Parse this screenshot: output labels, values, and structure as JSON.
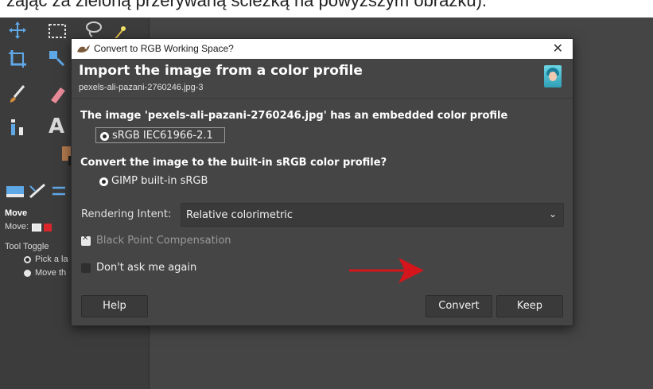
{
  "caption": {
    "text": "zając za zieloną przerywaną ścieżką na powyższym obrazku)."
  },
  "tool_options": {
    "title": "Move",
    "move_label": "Move:",
    "tool_toggle_label": "Tool Toggle",
    "option_pick": "Pick a la",
    "option_move": "Move th"
  },
  "dialog": {
    "window_title": "Convert to RGB Working Space?",
    "heading": "Import the image from a color profile",
    "subheading": "pexels-ali-pazani-2760246.jpg-3",
    "embedded_text": "The image 'pexels-ali-pazani-2760246.jpg' has an embedded color profile",
    "embedded_profile": "sRGB IEC61966-2.1",
    "convert_question": "Convert the image to the built-in sRGB color profile?",
    "builtin_profile": "GIMP built-in sRGB",
    "rendering_intent_label": "Rendering Intent:",
    "rendering_intent_value": "Relative colorimetric",
    "black_point_label": "Black Point Compensation",
    "black_point_checked": true,
    "dont_ask_label": "Don't ask me again",
    "dont_ask_checked": false,
    "buttons": {
      "help": "Help",
      "convert": "Convert",
      "keep": "Keep"
    }
  },
  "colors": {
    "dialog_bg": "#454545",
    "titlebar_bg": "#ffffff",
    "arrow": "#d4161c",
    "text": "#ffffff"
  },
  "icons": [
    "move-tool-icon",
    "rect-select-icon",
    "lasso-icon",
    "fuzzy-select-icon",
    "crop-icon",
    "transform-icon",
    "paintbrush-icon",
    "eraser-icon",
    "text-tool-icon",
    "gimp-wilber-icon",
    "close-icon",
    "chevron-down-icon",
    "user-avatar-icon"
  ]
}
